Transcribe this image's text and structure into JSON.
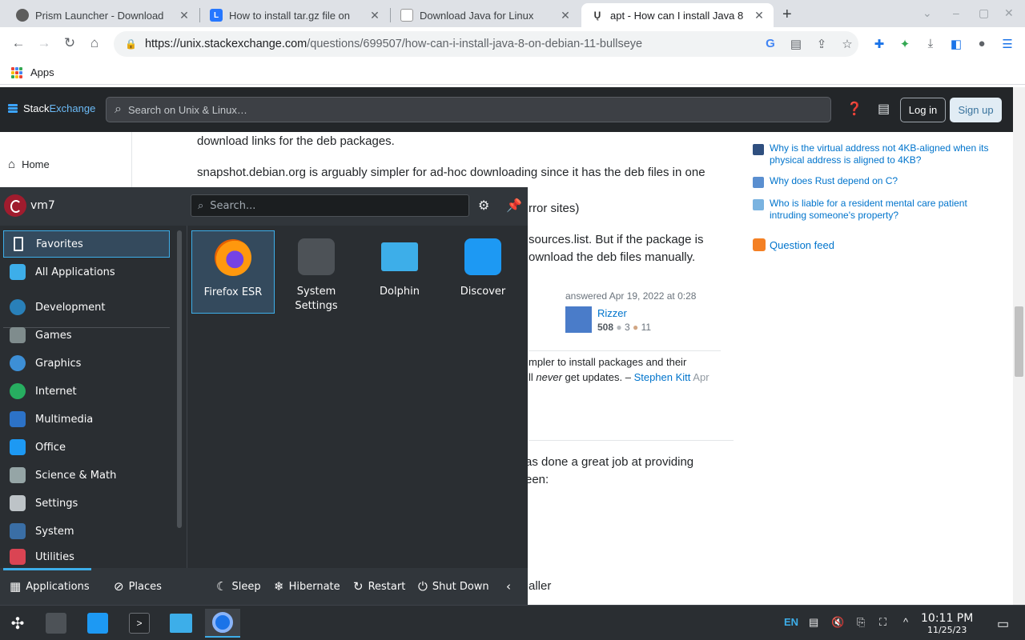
{
  "browser": {
    "tabs": [
      {
        "title": "Prism Launcher - Download",
        "favicon_color": "#5d5d5d"
      },
      {
        "title": "How to install tar.gz file on",
        "favicon_color": "#2677ff"
      },
      {
        "title": "Download Java for Linux",
        "favicon_color": "#ffffff"
      },
      {
        "title": "apt - How can I install Java 8",
        "favicon_color": "#ffffff",
        "active": true
      }
    ],
    "url_domain": "https://unix.stackexchange.com",
    "url_path": "/questions/699507/how-can-i-install-java-8-on-debian-11-bullseye",
    "bookmark_apps": "Apps"
  },
  "stackexchange": {
    "brand_stack": "Stack",
    "brand_exchange": "Exchange",
    "search_placeholder": "Search on Unix & Linux…",
    "login": "Log in",
    "signup": "Sign up",
    "nav_home": "Home"
  },
  "content": {
    "line1": "download links for the deb packages.",
    "line2": "snapshot.debian.org is arguably simpler for ad-hoc downloading since it has the deb files in one",
    "line3": "rror sites)",
    "line4": "sources.list. But if the package is",
    "line5": "ownload the deb files manually.",
    "answered": "answered Apr 19, 2022 at 0:28",
    "author": "Rizzer",
    "rep": "508",
    "silver": "3",
    "bronze": "11",
    "comment1": "mpler to install packages and their",
    "comment2_pre": "ll ",
    "comment2_em": "never",
    "comment2_post": " get updates. –",
    "comment_author": "Stephen Kitt",
    "comment_date": "Apr",
    "line6": "as done a great job at providing",
    "line7": "een:",
    "line8": "aller"
  },
  "sidebar": {
    "questions": [
      {
        "text": "Why is the virtual address not 4KB-aligned when its physical address is aligned to 4KB?",
        "color": "#2f4f7f"
      },
      {
        "text": "Why does Rust depend on C?",
        "color": "#5a8fd0"
      },
      {
        "text": "Who is liable for a resident mental care patient intruding someone's property?",
        "color": "#7ab3e0"
      }
    ],
    "feed": "Question feed"
  },
  "launcher": {
    "user": "vm7",
    "search_placeholder": "Search...",
    "categories": [
      {
        "label": "Favorites",
        "color": "#eff0f1"
      },
      {
        "label": "All Applications",
        "color": "#3daee9"
      },
      {
        "label": "Development",
        "color": "#2980b9"
      },
      {
        "label": "Games",
        "color": "#7f8c8d"
      },
      {
        "label": "Graphics",
        "color": "#3d8fd6"
      },
      {
        "label": "Internet",
        "color": "#27ae60"
      },
      {
        "label": "Multimedia",
        "color": "#2c72c7"
      },
      {
        "label": "Office",
        "color": "#1d99f3"
      },
      {
        "label": "Science & Math",
        "color": "#95a5a6"
      },
      {
        "label": "Settings",
        "color": "#bdc3c7"
      },
      {
        "label": "System",
        "color": "#3a6ea5"
      },
      {
        "label": "Utilities",
        "color": "#da4453"
      }
    ],
    "apps": [
      {
        "label": "Firefox ESR",
        "color": "#e66000"
      },
      {
        "label": "System Settings",
        "color": "#4d5257"
      },
      {
        "label": "Dolphin",
        "color": "#3daee9"
      },
      {
        "label": "Discover",
        "color": "#1d99f3"
      }
    ],
    "footer": {
      "applications": "Applications",
      "places": "Places",
      "sleep": "Sleep",
      "hibernate": "Hibernate",
      "restart": "Restart",
      "shutdown": "Shut Down"
    }
  },
  "taskbar": {
    "lang": "EN",
    "time": "10:11 PM",
    "date": "11/25/23"
  }
}
